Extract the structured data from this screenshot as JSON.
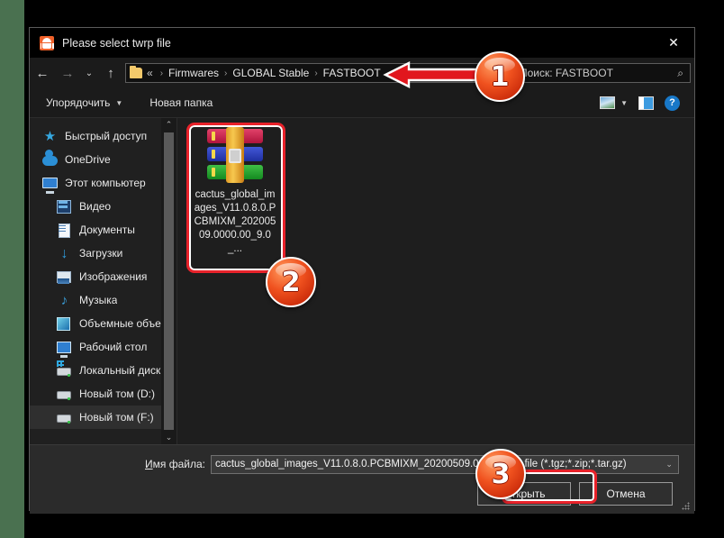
{
  "window": {
    "title": "Please select twrp file",
    "app_icon": "android-robot-icon",
    "close_label": "✕"
  },
  "nav": {
    "back": "←",
    "forward": "→",
    "recent": "⌄",
    "up": "↑",
    "breadcrumb": {
      "folder_icon": "folder-icon",
      "overflow": "«",
      "items": [
        "Firmwares",
        "GLOBAL Stable",
        "FASTBOOT"
      ],
      "separator": "›"
    },
    "search": {
      "placeholder": "Поиск: FASTBOOT",
      "icon": "⌕"
    }
  },
  "commandbar": {
    "organize": "Упорядочить",
    "organize_caret": "▼",
    "new_folder": "Новая папка",
    "view_caret": "▼",
    "help": "?"
  },
  "sidebar": {
    "items": [
      {
        "label": "Быстрый доступ",
        "icon": "star-icon",
        "indent": false,
        "selected": false
      },
      {
        "label": "OneDrive",
        "icon": "cloud-icon",
        "indent": false,
        "selected": false
      },
      {
        "label": "Этот компьютер",
        "icon": "computer-icon",
        "indent": false,
        "selected": false
      },
      {
        "label": "Видео",
        "icon": "video-icon",
        "indent": true,
        "selected": false
      },
      {
        "label": "Документы",
        "icon": "documents-icon",
        "indent": true,
        "selected": false
      },
      {
        "label": "Загрузки",
        "icon": "downloads-icon",
        "indent": true,
        "selected": false
      },
      {
        "label": "Изображения",
        "icon": "pictures-icon",
        "indent": true,
        "selected": false
      },
      {
        "label": "Музыка",
        "icon": "music-icon",
        "indent": true,
        "selected": false
      },
      {
        "label": "Объемные объекты",
        "icon": "3d-objects-icon",
        "indent": true,
        "selected": false
      },
      {
        "label": "Рабочий стол",
        "icon": "desktop-icon",
        "indent": true,
        "selected": false
      },
      {
        "label": "Локальный диск (C:)",
        "icon": "windows-drive-icon",
        "indent": true,
        "selected": false
      },
      {
        "label": "Новый том (D:)",
        "icon": "drive-icon",
        "indent": true,
        "selected": false
      },
      {
        "label": "Новый том (F:)",
        "icon": "drive-icon",
        "indent": true,
        "selected": true
      }
    ],
    "scroll_up": "⌃",
    "scroll_down": "⌄"
  },
  "files": [
    {
      "name_lines": [
        "cactus_global_im",
        "ages_V11.0.8.0.P",
        "CBMIXM_202005",
        "09.0000.00_9.0_..."
      ],
      "icon": "winrar-archive-icon"
    }
  ],
  "footer": {
    "filename_label_prefix": "И",
    "filename_label_rest": "мя файла:",
    "filename_value": "cactus_global_images_V11.0.8.0.PCBMIXM_20200509.00",
    "filter_value": "MIUI file (*.tgz;*.zip;*.tar.gz)",
    "filter_caret": "⌄",
    "open_prefix": "О",
    "open_rest": "ткрыть",
    "cancel": "Отмена"
  },
  "annotations": {
    "badges": [
      {
        "number": "1",
        "target": "address-bar"
      },
      {
        "number": "2",
        "target": "file-item"
      },
      {
        "number": "3",
        "target": "open-button"
      }
    ],
    "accent_color": "#e8222a",
    "badge_color": "#f0521f"
  }
}
